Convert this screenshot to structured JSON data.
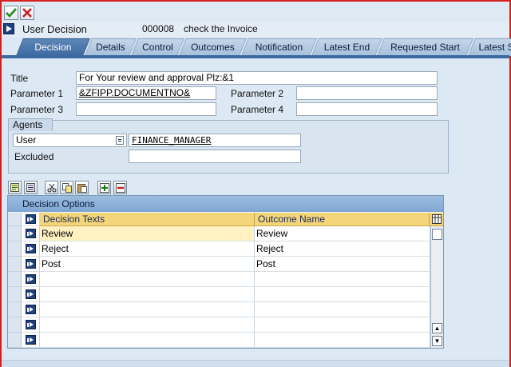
{
  "header": {
    "title": "User Decision",
    "task_id": "000008",
    "task_text": "check the Invoice"
  },
  "tabs": [
    {
      "label": "Decision",
      "active": true
    },
    {
      "label": "Details"
    },
    {
      "label": "Control"
    },
    {
      "label": "Outcomes"
    },
    {
      "label": "Notification"
    },
    {
      "label": "Latest End"
    },
    {
      "label": "Requested Start"
    },
    {
      "label": "Latest St"
    }
  ],
  "form": {
    "title_label": "Title",
    "title_value": "For Your review and approval Plz:&1",
    "param1_label": "Parameter 1",
    "param1_value": "&ZFIPP.DOCUMENTNO&",
    "param2_label": "Parameter 2",
    "param2_value": "",
    "param3_label": "Parameter 3",
    "param3_value": "",
    "param4_label": "Parameter 4",
    "param4_value": ""
  },
  "agents": {
    "group_label": "Agents",
    "type_label": "User",
    "type_value": "FINANCE_MANAGER",
    "excluded_label": "Excluded",
    "excluded_value": ""
  },
  "table": {
    "title": "Decision Options",
    "col1_header": "Decision Texts",
    "col2_header": "Outcome Name",
    "rows": [
      {
        "text": "Review",
        "outcome": "Review"
      },
      {
        "text": "Reject",
        "outcome": "Reject"
      },
      {
        "text": "Post",
        "outcome": "Post"
      },
      {
        "text": "",
        "outcome": ""
      },
      {
        "text": "",
        "outcome": ""
      },
      {
        "text": "",
        "outcome": ""
      },
      {
        "text": "",
        "outcome": ""
      },
      {
        "text": "",
        "outcome": ""
      }
    ]
  },
  "icons": {
    "confirm": "check-icon",
    "cancel": "cross-icon"
  },
  "colors": {
    "active_tab": "#3d6aa2",
    "table_header": "#f3d57a",
    "window_border": "#d42020"
  }
}
